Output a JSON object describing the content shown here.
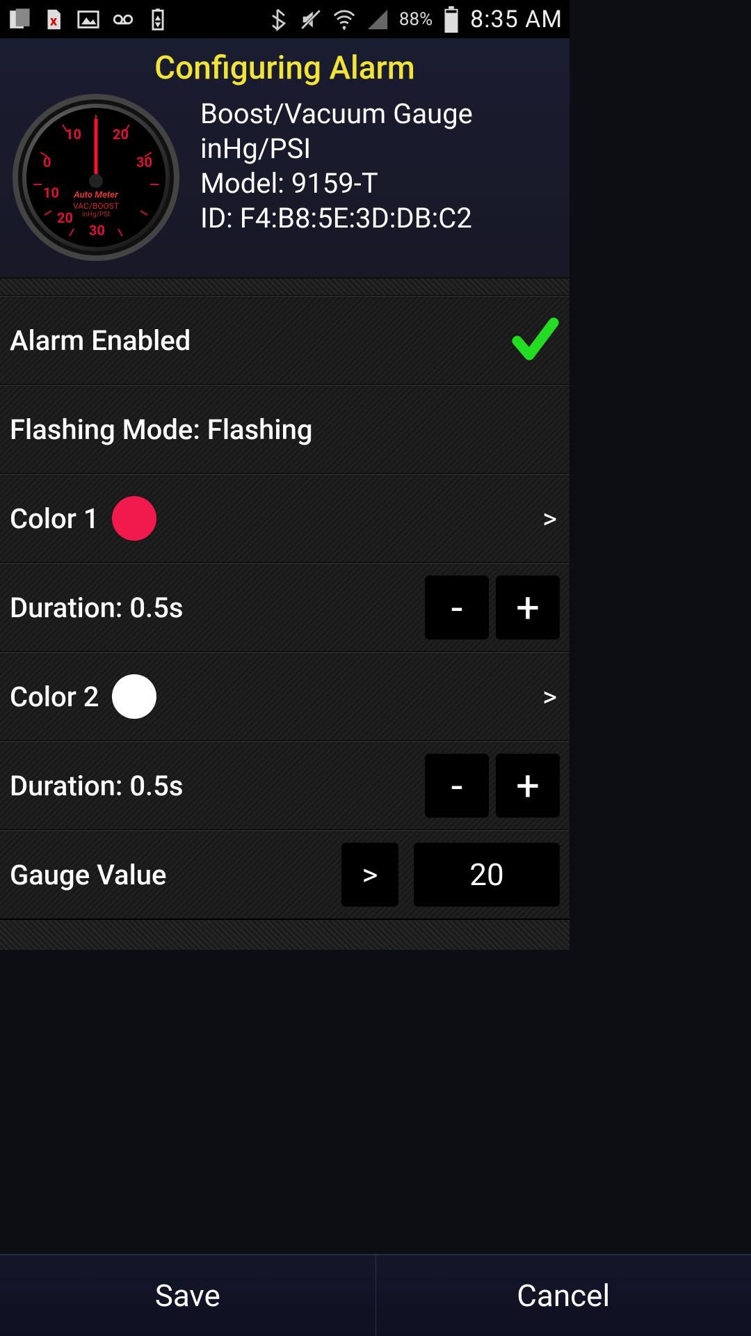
{
  "status": {
    "battery_pct": "88%",
    "time": "8:35 AM"
  },
  "page_title": "Configuring Alarm",
  "device": {
    "name": "Boost/Vacuum Gauge",
    "units": "inHg/PSI",
    "model_line": "Model: 9159-T",
    "id_line": "ID: F4:B8:5E:3D:DB:C2",
    "gauge_brand": "Auto Meter",
    "gauge_sub": "VAC/BOOST",
    "gauge_sub2": "inHg/PSI",
    "gauge_digits": [
      "10",
      "20",
      "0",
      "30",
      "10",
      "20",
      "30"
    ]
  },
  "settings": {
    "alarm_enabled_label": "Alarm Enabled",
    "alarm_enabled": true,
    "flashing_mode_label": "Flashing Mode: Flashing",
    "color1": {
      "label": "Color 1",
      "hex": "#f21a4d"
    },
    "duration1": {
      "label": "Duration: 0.5s",
      "minus": "-",
      "plus": "+"
    },
    "color2": {
      "label": "Color 2",
      "hex": "#ffffff"
    },
    "duration2": {
      "label": "Duration: 0.5s",
      "minus": "-",
      "plus": "+"
    },
    "gauge_value": {
      "label": "Gauge Value",
      "operator": ">",
      "value": "20"
    }
  },
  "footer": {
    "save": "Save",
    "cancel": "Cancel"
  },
  "chevron": ">"
}
